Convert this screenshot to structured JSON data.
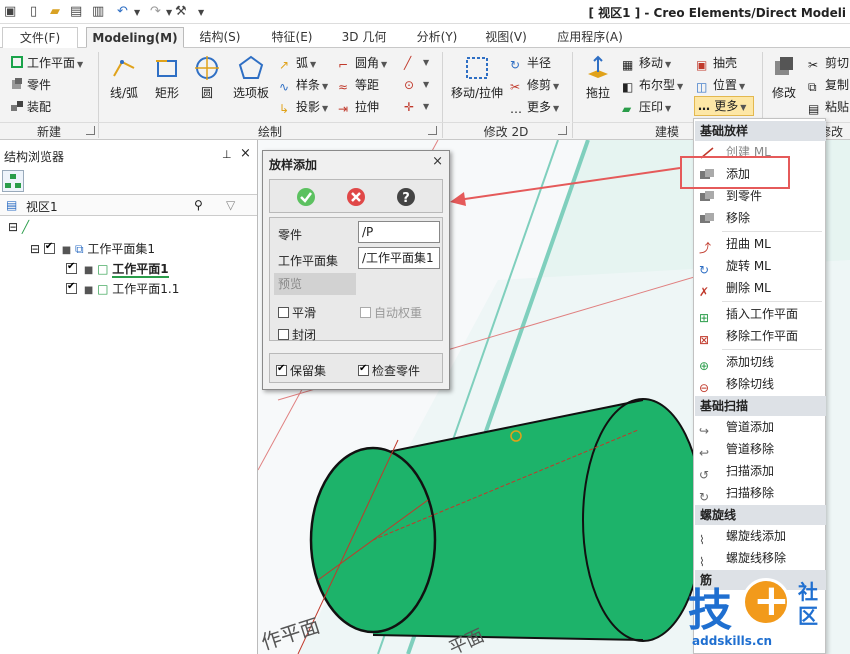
{
  "app_title": "[ 视区1 ] - Creo Elements/Direct Modeli",
  "tabs": [
    {
      "label": "文件(F)"
    },
    {
      "label": "Modeling(M)"
    },
    {
      "label": "结构(S)"
    },
    {
      "label": "特征(E)"
    },
    {
      "label": "3D 几何"
    },
    {
      "label": "分析(Y)"
    },
    {
      "label": "视图(V)"
    },
    {
      "label": "应用程序(A)"
    }
  ],
  "ribbon": {
    "new_group": {
      "label": "新建",
      "workplane": "工作平面",
      "part": "零件",
      "assembly": "装配"
    },
    "draw_group": {
      "label": "绘制",
      "line_arc": "线/弧",
      "rect": "矩形",
      "circle": "圆",
      "palette": "选项板",
      "arc": "弧",
      "spline": "样条",
      "project": "投影",
      "fillet": "圆角",
      "offset": "等距",
      "extend": "拉伸"
    },
    "modify2d_group": {
      "label": "修改 2D",
      "move_stretch": "移动/拉伸",
      "radius": "半径",
      "trim": "修剪",
      "more": "更多"
    },
    "model_group": {
      "label": "建模",
      "pull": "拖拉",
      "move": "移动",
      "boolean": "布尔型",
      "imprint": "压印",
      "shell": "抽壳",
      "position": "位置",
      "more": "更多"
    },
    "modify_group": {
      "label": "修改",
      "modify": "修改",
      "cut": "剪切",
      "copy": "复制",
      "paste": "粘贴"
    }
  },
  "browser": {
    "title": "结构浏览器",
    "viewport_name": "视区1",
    "tree": [
      {
        "label": "工作平面集1"
      },
      {
        "label": "工作平面1"
      },
      {
        "label": "工作平面1.1"
      }
    ]
  },
  "dialog": {
    "title": "放样添加",
    "close": "×",
    "part_label": "零件",
    "part_value": "/P",
    "wpset_label": "工作平面集",
    "wpset_value": "/工作平面集1",
    "preview": "预览",
    "smooth": "平滑",
    "auto_weight": "自动权重",
    "closed": "封闭",
    "keep_set": "保留集",
    "check_part": "检查零件"
  },
  "menu": {
    "sections": [
      {
        "title": "基础放样",
        "items": [
          "创建 ML",
          "添加",
          "到零件",
          "移除",
          "扭曲 ML",
          "旋转 ML",
          "删除 ML",
          "插入工作平面",
          "移除工作平面",
          "添加切线",
          "移除切线"
        ]
      },
      {
        "title": "基础扫描",
        "items": [
          "管道添加",
          "管道移除",
          "扫描添加",
          "扫描移除"
        ]
      },
      {
        "title": "螺旋线",
        "items": [
          "螺旋线添加",
          "螺旋线移除"
        ]
      },
      {
        "title": "筋",
        "items": []
      }
    ]
  },
  "viewport": {
    "watermark_text": "作平面",
    "watermark_text2": "平面"
  },
  "logo": {
    "site": "addskills.cn",
    "c1": "技",
    "c2": "社",
    "c3": "区"
  },
  "colors": {
    "cylinder": "#1db36a",
    "highlight": "#e55a5a",
    "accent": "#1f6fd0"
  }
}
